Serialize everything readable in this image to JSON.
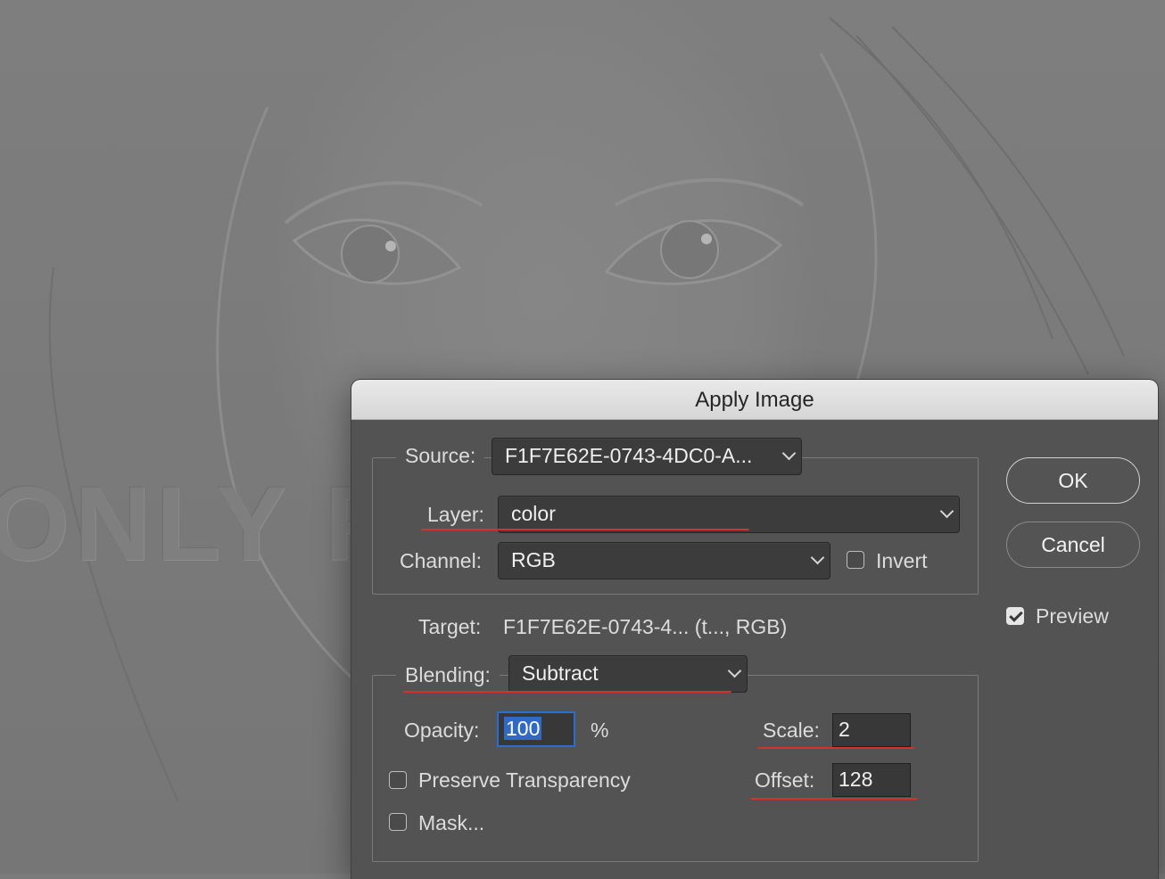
{
  "background": {
    "watermark_text": "ONLY F"
  },
  "dialog": {
    "title": "Apply Image",
    "source_label": "Source:",
    "source_value": "F1F7E62E-0743-4DC0-A...",
    "layer_label": "Layer:",
    "layer_value": "color",
    "channel_label": "Channel:",
    "channel_value": "RGB",
    "invert_label": "Invert",
    "invert_checked": false,
    "target_label": "Target:",
    "target_value": "F1F7E62E-0743-4... (t..., RGB)",
    "blending_label": "Blending:",
    "blending_value": "Subtract",
    "opacity_label": "Opacity:",
    "opacity_value": "100",
    "percent_sign": "%",
    "scale_label": "Scale:",
    "scale_value": "2",
    "offset_label": "Offset:",
    "offset_value": "128",
    "preserve_transparency_label": "Preserve Transparency",
    "preserve_transparency_checked": false,
    "mask_label": "Mask...",
    "mask_checked": false,
    "ok_label": "OK",
    "cancel_label": "Cancel",
    "preview_label": "Preview",
    "preview_checked": true
  },
  "colors": {
    "annotation_underline": "#d3322d",
    "focus_ring": "#2c6cd6",
    "dialog_bg": "#535353"
  }
}
